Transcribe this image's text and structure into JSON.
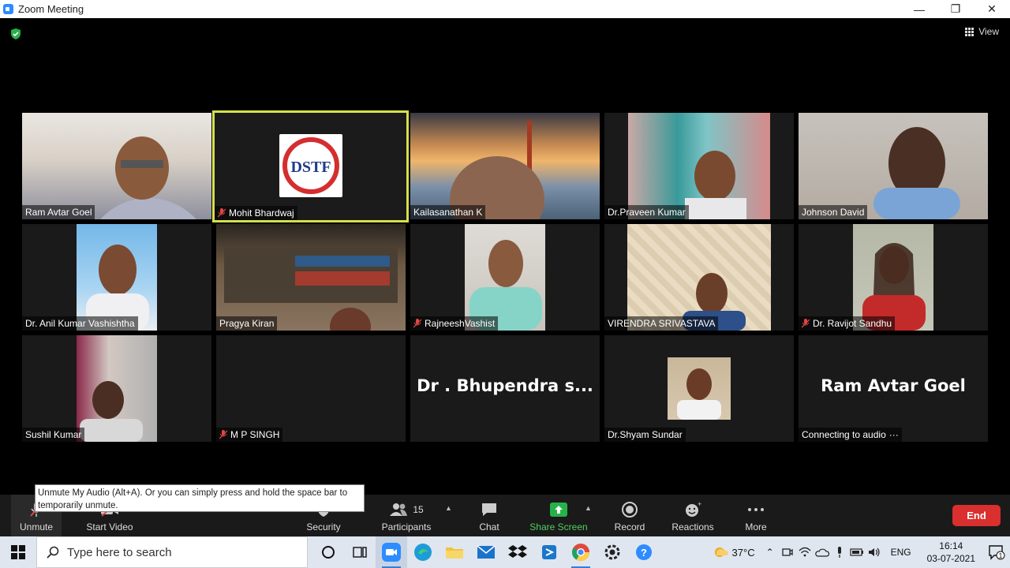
{
  "window": {
    "title": "Zoom Meeting"
  },
  "view_button": {
    "label": "View"
  },
  "tiles": [
    {
      "name": "Ram Avtar Goel",
      "muted": false
    },
    {
      "name": "Mohit Bhardwaj",
      "muted": true
    },
    {
      "name": "Kailasanathan K",
      "muted": false
    },
    {
      "name": "Dr.Praveen Kumar",
      "muted": false
    },
    {
      "name": "Johnson David",
      "muted": false
    },
    {
      "name": "Dr. Anil Kumar Vashishtha",
      "muted": false
    },
    {
      "name": "Pragya Kiran",
      "muted": false
    },
    {
      "name": "RajneeshVashist",
      "muted": true
    },
    {
      "name": "VIRENDRA SRIVASTAVA",
      "muted": false
    },
    {
      "name": "Dr. Ravijot Sandhu",
      "muted": true
    },
    {
      "name": "Sushil Kumar",
      "muted": false
    },
    {
      "name": "M P SINGH",
      "muted": true
    },
    {
      "name": "",
      "big_name": "Dr . Bhupendra s...",
      "muted": false
    },
    {
      "name": "Dr.Shyam Sundar",
      "muted": false
    },
    {
      "name": "Connecting to audio",
      "big_name": "Ram Avtar Goel",
      "status_suffix": "···"
    }
  ],
  "logo_text": "DSTF",
  "toolbar": {
    "unmute": "Unmute",
    "start_video": "Start Video",
    "security": "Security",
    "participants": "Participants",
    "participants_count": "15",
    "chat": "Chat",
    "share_screen": "Share Screen",
    "record": "Record",
    "reactions": "Reactions",
    "more": "More",
    "end": "End"
  },
  "tooltip": "Unmute My Audio (Alt+A). Or you can simply press and hold the space bar to temporarily unmute.",
  "taskbar": {
    "search_placeholder": "Type here to search",
    "temperature": "37°C",
    "language": "ENG",
    "time": "16:14",
    "date": "03-07-2021",
    "notification_count": "1"
  },
  "colors": {
    "active_speaker": "#d6e04a",
    "end": "#d92f2f",
    "share_green": "#4fcf5c",
    "zoom_blue": "#2d8cff"
  }
}
